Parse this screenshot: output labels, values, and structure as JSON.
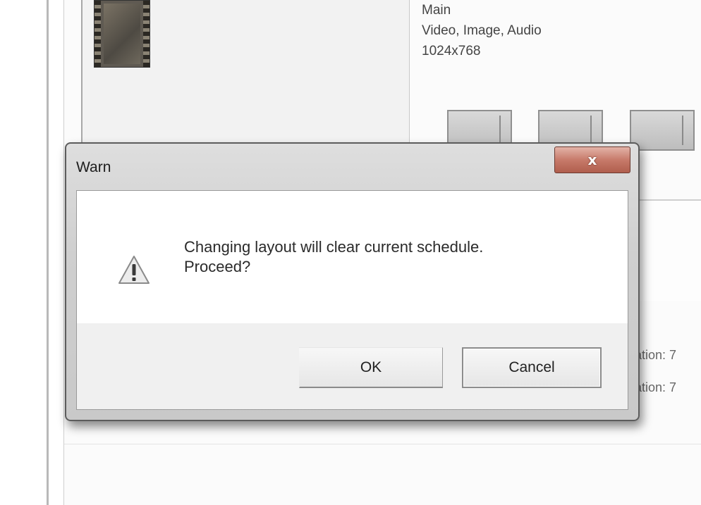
{
  "background": {
    "layout_info": {
      "name": "Main",
      "media_types": "Video, Image, Audio",
      "resolution": "1024x768"
    },
    "right_labels": [
      "ation: 7",
      "ation: 7"
    ]
  },
  "dialog": {
    "title": "Warn",
    "close_label": "x",
    "message_line1": "Changing layout will clear current schedule.",
    "message_line2": "Proceed?",
    "ok_label": "OK",
    "cancel_label": "Cancel",
    "icon": "warning-triangle-icon"
  },
  "colors": {
    "close_button": "#c77a6a",
    "dialog_frame": "#cfcfcf",
    "warning_icon_fill": "#e8e8e8"
  }
}
